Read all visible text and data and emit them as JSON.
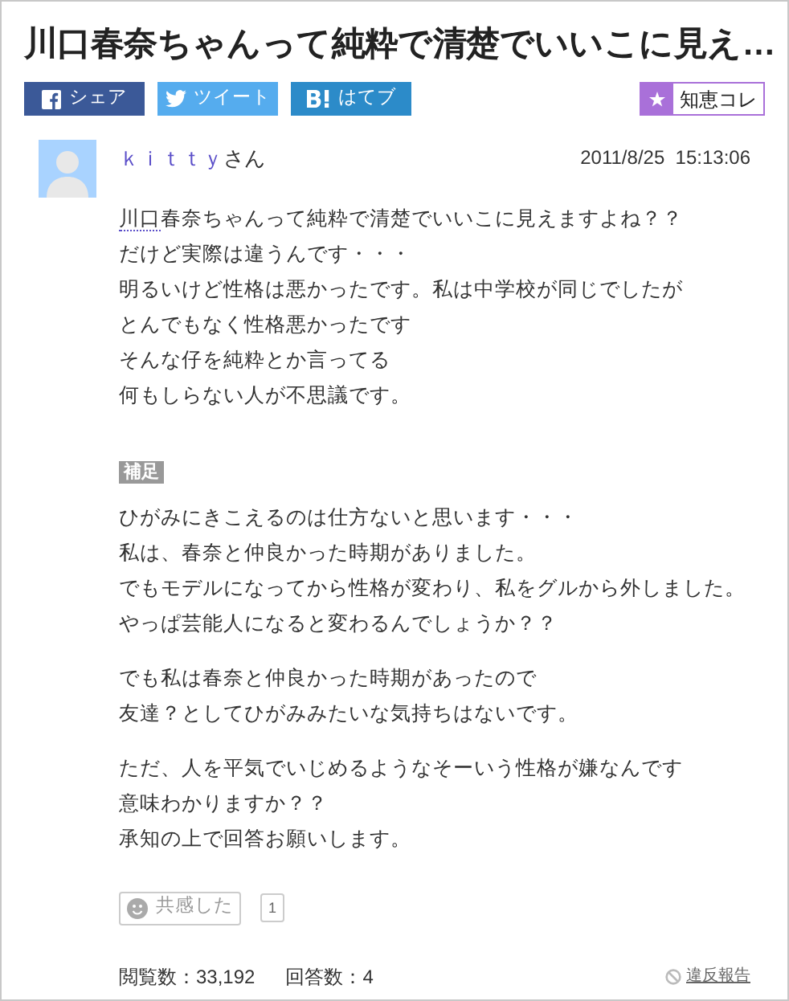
{
  "title": "川口春奈ちゃんって純粋で清楚でいいこに見え…",
  "share_buttons": [
    {
      "kind": "facebook",
      "label": "シェア"
    },
    {
      "kind": "twitter",
      "label": "ツイート"
    },
    {
      "kind": "hatena",
      "label": "はてブ"
    }
  ],
  "collection_button": {
    "label": "知恵コレ"
  },
  "question": {
    "user": "ｋｉｔｔｙ",
    "honorific": "さん",
    "date": "2011/8/25  15:13:06",
    "link": "川口",
    "lines": [
      "春奈ちゃんって純粋で清楚でいいこに見えますよね？？",
      "だけど実際は違うんです・・・",
      "明るいけど性格は悪かったです。私は中学校が同じでしたが",
      "とんでもなく性格悪かったです",
      "そんな仔を純粋とか言ってる",
      "何もしらない人が不思議です。"
    ]
  },
  "supplement": {
    "label": "補足",
    "paragraphs": [
      [
        "ひがみにきこえるのは仕方ないと思います・・・",
        "私は、春奈と仲良かった時期がありました。",
        "でもモデルになってから性格が変わり、私をグルから外しました。",
        "やっぱ芸能人になると変わるんでしょうか？？"
      ],
      [
        "でも私は春奈と仲良かった時期があったので",
        "友達？としてひがみみたいな気持ちはないです。"
      ],
      [
        "ただ、人を平気でいじめるようなそーいう性格が嫌なんです",
        "意味わかりますか？？",
        "承知の上で回答お願いします。"
      ]
    ]
  },
  "empathy": {
    "label": "共感した",
    "count": "1"
  },
  "footer": {
    "views": "閲覧数：33,192",
    "answers": "回答数：4",
    "report": "違反報告"
  }
}
